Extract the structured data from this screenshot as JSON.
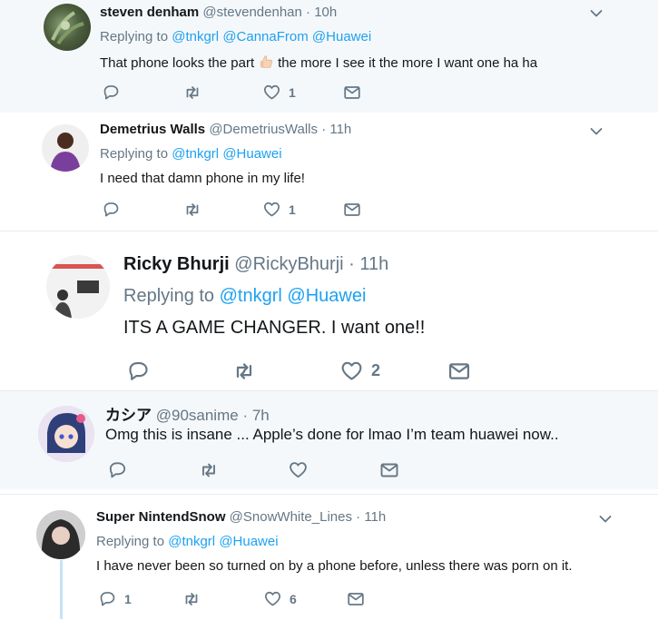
{
  "tweets": [
    {
      "name": "steven denham",
      "handle": "@stevendenhan",
      "time": "10h",
      "replying_label": "Replying to",
      "mentions": [
        "@tnkgrl",
        "@CannaFrom",
        "@Huawei"
      ],
      "text_before": "That phone looks the part",
      "text_after": "the more I see it the more I want one ha ha",
      "likes": "1"
    },
    {
      "name": "Demetrius Walls",
      "handle": "@DemetriusWalls",
      "time": "11h",
      "replying_label": "Replying to",
      "mentions": [
        "@tnkgrl",
        "@Huawei"
      ],
      "text": "I need that damn phone in my life!",
      "likes": "1"
    },
    {
      "name": "Ricky Bhurji",
      "handle": "@RickyBhurji",
      "time": "11h",
      "replying_label": "Replying to",
      "mentions": [
        "@tnkgrl",
        "@Huawei"
      ],
      "text": "ITS A GAME CHANGER. I want one!!",
      "likes": "2"
    },
    {
      "name": "カシア",
      "handle": "@90sanime",
      "time": "7h",
      "text": "Omg this is insane ... Apple’s done for lmao I’m team huawei now.."
    },
    {
      "name": "Super NintendSnow",
      "handle": "@SnowWhite_Lines",
      "time": "11h",
      "replying_label": "Replying to",
      "mentions": [
        "@tnkgrl",
        "@Huawei"
      ],
      "text": "I have never been so turned on by a phone before, unless there was porn on it.",
      "replies": "1",
      "likes": "6"
    }
  ],
  "separator": "·",
  "colors": {
    "link": "#1da1f2",
    "muted": "#657786",
    "text": "#14171a",
    "thread_line": "#c6e2f7"
  },
  "icons": [
    "reply-icon",
    "retweet-icon",
    "like-icon",
    "message-icon",
    "chevron-down-icon",
    "thumbs-up-emoji"
  ]
}
